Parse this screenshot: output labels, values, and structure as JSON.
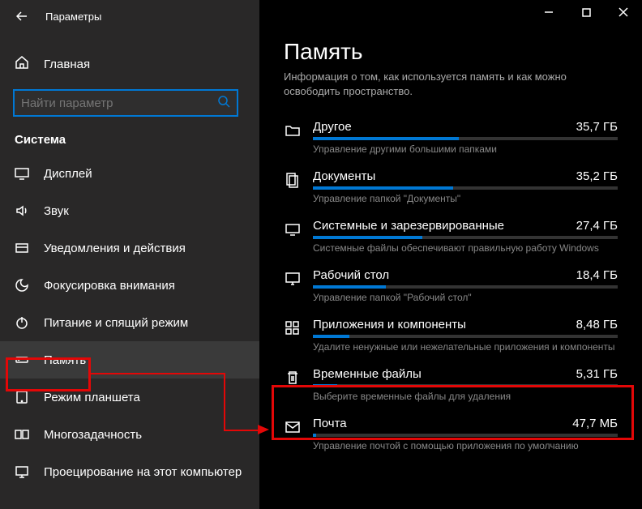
{
  "window": {
    "title": "Параметры"
  },
  "sidebar": {
    "home_label": "Главная",
    "search_placeholder": "Найти параметр",
    "section_header": "Система",
    "items": [
      {
        "label": "Дисплей",
        "icon": "display"
      },
      {
        "label": "Звук",
        "icon": "sound"
      },
      {
        "label": "Уведомления и действия",
        "icon": "notifications"
      },
      {
        "label": "Фокусировка внимания",
        "icon": "focus"
      },
      {
        "label": "Питание и спящий режим",
        "icon": "power"
      },
      {
        "label": "Память",
        "icon": "storage",
        "active": true
      },
      {
        "label": "Режим планшета",
        "icon": "tablet"
      },
      {
        "label": "Многозадачность",
        "icon": "multitask"
      },
      {
        "label": "Проецирование на этот компьютер",
        "icon": "project"
      }
    ]
  },
  "page": {
    "title": "Память",
    "subtitle": "Информация о том, как используется память и как можно освободить пространство."
  },
  "categories": [
    {
      "name": "Другое",
      "size": "35,7 ГБ",
      "desc": "Управление другими большими папками",
      "fill": 48,
      "icon": "folder"
    },
    {
      "name": "Документы",
      "size": "35,2 ГБ",
      "desc": "Управление папкой \"Документы\"",
      "fill": 46,
      "icon": "documents"
    },
    {
      "name": "Системные и зарезервированные",
      "size": "27,4 ГБ",
      "desc": "Системные файлы обеспечивают правильную работу Windows",
      "fill": 36,
      "icon": "system"
    },
    {
      "name": "Рабочий стол",
      "size": "18,4 ГБ",
      "desc": "Управление папкой \"Рабочий стол\"",
      "fill": 24,
      "icon": "desktop"
    },
    {
      "name": "Приложения и компоненты",
      "size": "8,48 ГБ",
      "desc": "Удалите ненужные или нежелательные приложения и компоненты",
      "fill": 12,
      "icon": "apps"
    },
    {
      "name": "Временные файлы",
      "size": "5,31 ГБ",
      "desc": "Выберите временные файлы для удаления",
      "fill": 8,
      "icon": "trash"
    },
    {
      "name": "Почта",
      "size": "47,7 МБ",
      "desc": "Управление почтой с помощью приложения по умолчанию",
      "fill": 1,
      "icon": "mail"
    }
  ]
}
